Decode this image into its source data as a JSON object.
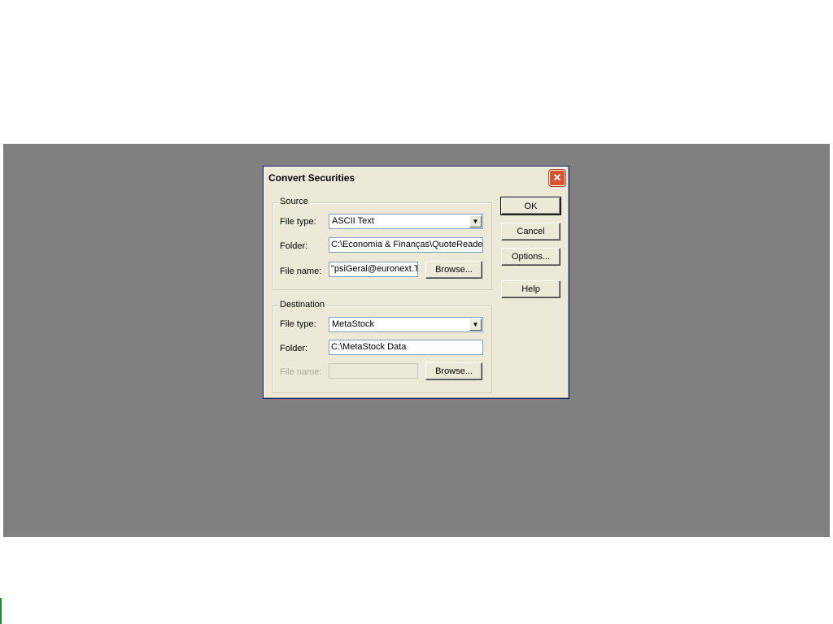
{
  "dialog": {
    "title": "Convert Securities",
    "close_glyph": "✕"
  },
  "source": {
    "legend": "Source",
    "file_type_label": "File type:",
    "file_type_value": "ASCII Text",
    "folder_label": "Folder:",
    "folder_value": "C:\\Economia & Finanças\\QuoteReader",
    "file_name_label": "File name:",
    "file_name_value": "\"psiGeral@euronext.T",
    "browse_label": "Browse..."
  },
  "destination": {
    "legend": "Destination",
    "file_type_label": "File type:",
    "file_type_value": "MetaStock",
    "folder_label": "Folder:",
    "folder_value": "C:\\MetaStock Data",
    "file_name_label": "File name:",
    "file_name_value": "",
    "browse_label": "Browse..."
  },
  "buttons": {
    "ok": "OK",
    "cancel": "Cancel",
    "options": "Options...",
    "help": "Help"
  },
  "icons": {
    "dropdown": "▼",
    "close": "close-icon"
  }
}
